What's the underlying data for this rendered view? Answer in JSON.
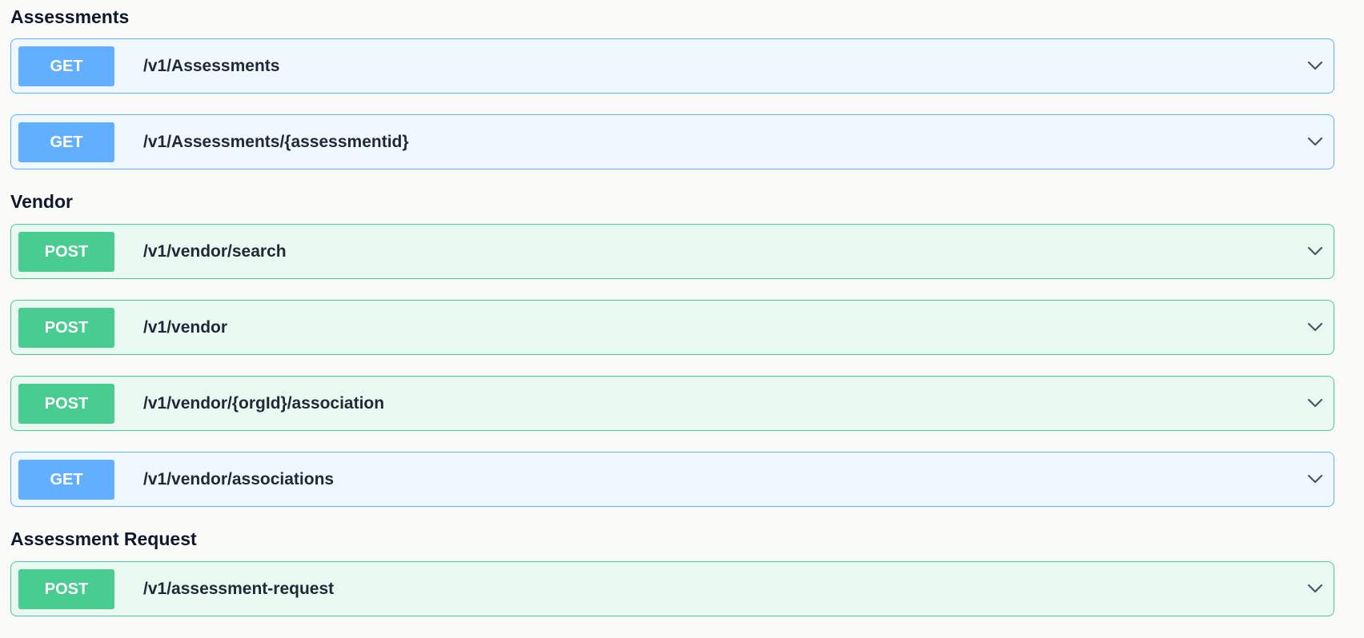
{
  "sections": [
    {
      "title": "Assessments",
      "operations": [
        {
          "method": "GET",
          "path": "/v1/Assessments"
        },
        {
          "method": "GET",
          "path": "/v1/Assessments/{assessmentid}"
        }
      ]
    },
    {
      "title": "Vendor",
      "operations": [
        {
          "method": "POST",
          "path": "/v1/vendor/search"
        },
        {
          "method": "POST",
          "path": "/v1/vendor"
        },
        {
          "method": "POST",
          "path": "/v1/vendor/{orgId}/association"
        },
        {
          "method": "GET",
          "path": "/v1/vendor/associations"
        }
      ]
    },
    {
      "title": "Assessment Request",
      "operations": [
        {
          "method": "POST",
          "path": "/v1/assessment-request"
        }
      ]
    }
  ],
  "colors": {
    "get": "#61affe",
    "get_bg": "#eff7ff",
    "post": "#49cc90",
    "post_bg": "#e9f8f0",
    "chevron": "#4b5563"
  },
  "icons": {
    "expand": "chevron-down-icon"
  }
}
